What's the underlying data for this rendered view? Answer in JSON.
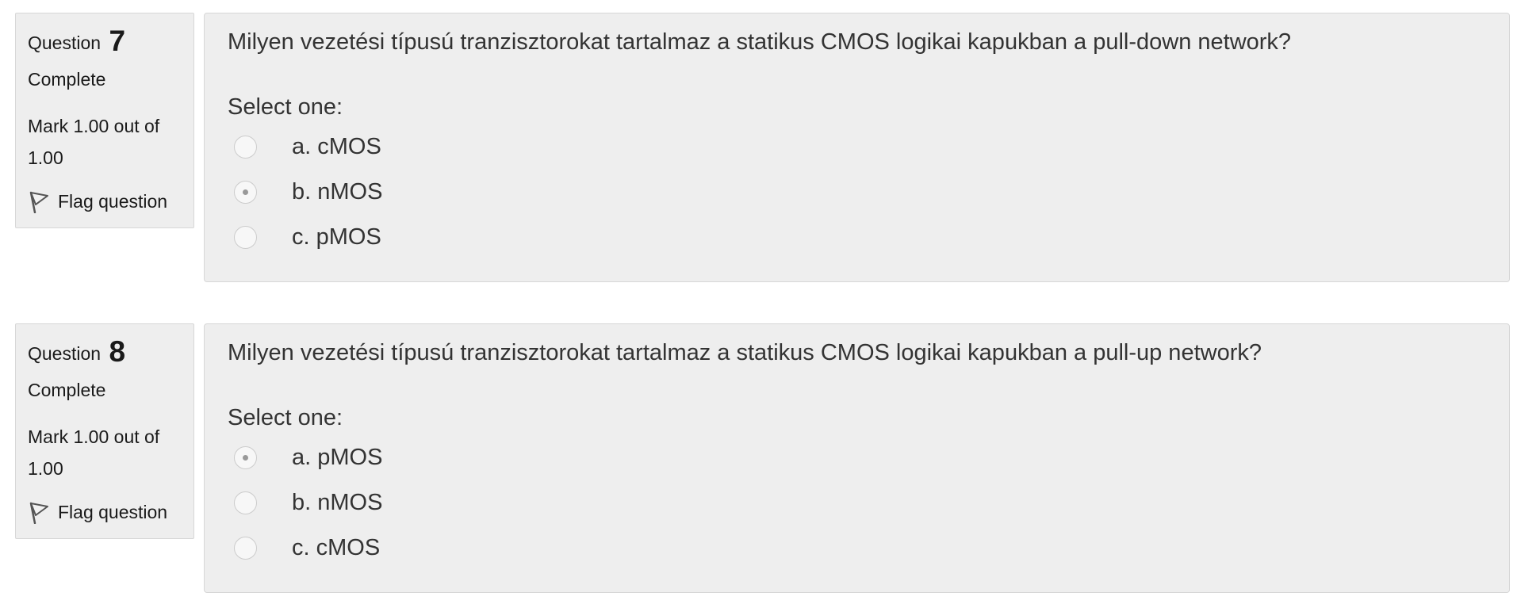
{
  "questions": [
    {
      "label": "Question",
      "number": "7",
      "state": "Complete",
      "grade": "Mark 1.00 out of 1.00",
      "flag_label": "Flag question",
      "text": "Milyen vezetési típusú tranzisztorokat tartalmaz a statikus CMOS logikai kapukban a pull-down network?",
      "prompt": "Select one:",
      "answers": [
        {
          "label": "a. cMOS",
          "checked": false
        },
        {
          "label": "b. nMOS",
          "checked": true
        },
        {
          "label": "c. pMOS",
          "checked": false
        }
      ]
    },
    {
      "label": "Question",
      "number": "8",
      "state": "Complete",
      "grade": "Mark 1.00 out of 1.00",
      "flag_label": "Flag question",
      "text": "Milyen vezetési típusú tranzisztorokat tartalmaz a statikus CMOS logikai kapukban a pull-up network?",
      "prompt": "Select one:",
      "answers": [
        {
          "label": "a. pMOS",
          "checked": true
        },
        {
          "label": "b. nMOS",
          "checked": false
        },
        {
          "label": "c. cMOS",
          "checked": false
        }
      ]
    }
  ]
}
